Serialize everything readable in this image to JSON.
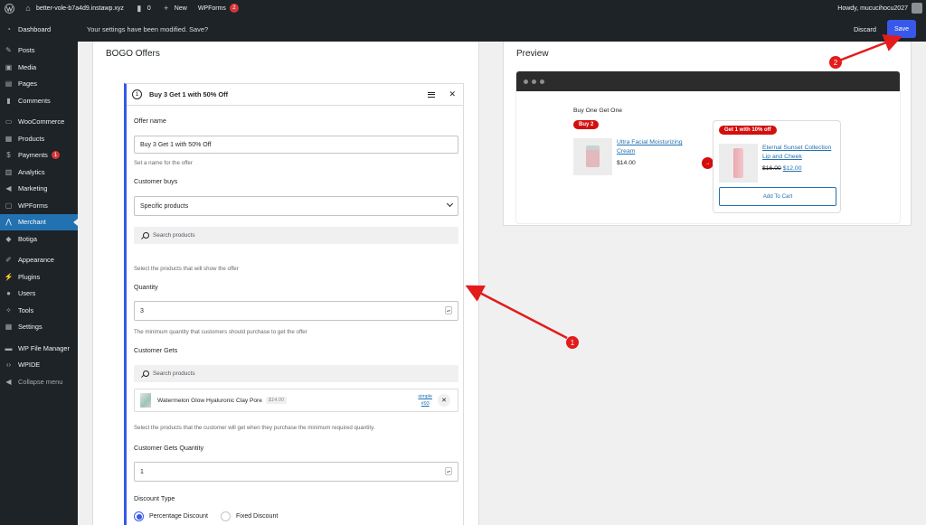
{
  "adminbar": {
    "site_name": "better-vole-b7a4d9.instawp.xyz",
    "comments_count": "0",
    "new_label": "New",
    "wpforms_label": "WPForms",
    "wpforms_badge": "2",
    "howdy": "Howdy, mucucihocu2027"
  },
  "notice": {
    "message": "Your settings have been modified. Save?",
    "discard": "Discard",
    "save": "Save"
  },
  "sidebar": {
    "items": [
      {
        "label": "Dashboard",
        "icon": "dashboard-icon"
      },
      {
        "label": "Posts",
        "icon": "pin-icon"
      },
      {
        "label": "Media",
        "icon": "media-icon"
      },
      {
        "label": "Pages",
        "icon": "pages-icon"
      },
      {
        "label": "Comments",
        "icon": "comment-icon"
      },
      {
        "label": "WooCommerce",
        "icon": "woo-icon"
      },
      {
        "label": "Products",
        "icon": "products-icon"
      },
      {
        "label": "Payments",
        "icon": "payments-icon",
        "badge": "1"
      },
      {
        "label": "Analytics",
        "icon": "analytics-icon"
      },
      {
        "label": "Marketing",
        "icon": "megaphone-icon"
      },
      {
        "label": "WPForms",
        "icon": "forms-icon"
      },
      {
        "label": "Merchant",
        "icon": "merchant-icon"
      },
      {
        "label": "Botiga",
        "icon": "botiga-icon"
      },
      {
        "label": "Appearance",
        "icon": "brush-icon"
      },
      {
        "label": "Plugins",
        "icon": "plugin-icon"
      },
      {
        "label": "Users",
        "icon": "user-icon"
      },
      {
        "label": "Tools",
        "icon": "wrench-icon"
      },
      {
        "label": "Settings",
        "icon": "settings-icon"
      },
      {
        "label": "WP File Manager",
        "icon": "file-manager-icon"
      },
      {
        "label": "WPIDE",
        "icon": "code-icon"
      },
      {
        "label": "Collapse menu",
        "icon": "collapse-icon"
      }
    ],
    "active": "Merchant"
  },
  "bogo": {
    "panel_title": "BOGO Offers",
    "offer_number": "1",
    "offer_title": "Buy 3 Get 1 with 50% Off",
    "offer_name_label": "Offer name",
    "offer_name_value": "Buy 3 Get 1 with 50% Off",
    "offer_name_help": "Set a name for the offer",
    "customer_buys_label": "Customer buys",
    "customer_buys_value": "Specific products",
    "search_placeholder": "Search products",
    "buys_help": "Select the products that will show the offer",
    "quantity_label": "Quantity",
    "quantity_value": "3",
    "quantity_help": "The minimum quantity that customers should purchase to get the offer",
    "customer_gets_label": "Customer Gets",
    "gets_search_placeholder": "Search products",
    "gets_item_name": "Watermelon Glow Hyaluronic Clay Pore",
    "gets_item_price": "$14.00",
    "gets_item_type": "simple",
    "gets_item_id": "#93",
    "gets_help": "Select the products that the customer will get when they purchase the minimum required quantity.",
    "gets_quantity_label": "Customer Gets Quantity",
    "gets_quantity_value": "1",
    "discount_type_label": "Discount Type",
    "discount_options": [
      "Percentage Discount",
      "Fixed Discount"
    ],
    "discount_selected": "Percentage Discount"
  },
  "preview": {
    "title": "Preview",
    "heading": "Buy One Get One",
    "buy_badge": "Buy 2",
    "product_a_name": "Ultra Facial Moisturizing Cream",
    "product_a_price": "$14.00",
    "gets_badge": "Get 1 with 10% off",
    "product_b_name": "Eternal Sunset Collection Lip and Cheek",
    "product_b_old_price": "$16.00",
    "product_b_new_price": "$12.00",
    "add_to_cart": "Add To Cart"
  },
  "annotations": {
    "badge_1": "1",
    "badge_2": "2"
  },
  "colors": {
    "admin_dark": "#1d2327",
    "accent": "#3858e9",
    "active_menu": "#2271b1",
    "badge_red": "#d63638",
    "preview_red": "#d20f0f",
    "annotation_red": "#e41b1b"
  }
}
